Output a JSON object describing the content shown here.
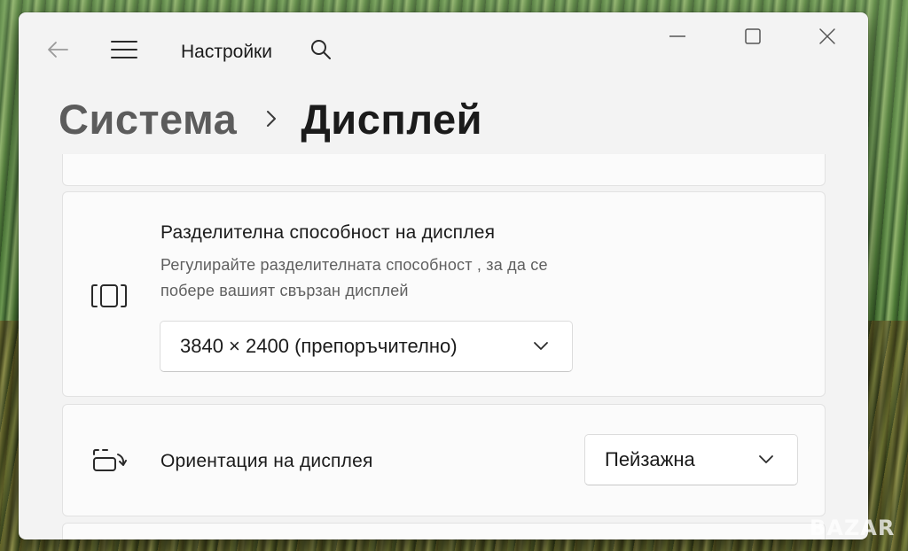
{
  "app": {
    "title": "Настройки"
  },
  "window_controls": {
    "minimize_icon": "minimize-icon",
    "maximize_icon": "maximize-icon",
    "close_icon": "close-icon"
  },
  "nav": {
    "back_icon": "back-arrow-icon",
    "menu_icon": "hamburger-menu-icon",
    "search_icon": "search-icon"
  },
  "breadcrumb": {
    "parent": "Система",
    "separator_icon": "chevron-right-icon",
    "current": "Дисплей"
  },
  "resolution": {
    "icon": "resolution-icon",
    "title": "Разделителна способност на дисплея",
    "description_line1": "Регулирайте разделителната способност , за да се",
    "description_line2": "побере вашият свързан дисплей",
    "selected_value": "3840 × 2400 (препоръчително)"
  },
  "orientation": {
    "icon": "orientation-icon",
    "title": "Ориентация на дисплея",
    "selected_value": "Пейзажна"
  },
  "watermark": {
    "text": "BAZAR"
  },
  "colors": {
    "window_bg": "#f3f3f3",
    "card_bg": "#fbfbfb",
    "text_primary": "#1b1b1b",
    "text_secondary": "#5f5f5f"
  }
}
